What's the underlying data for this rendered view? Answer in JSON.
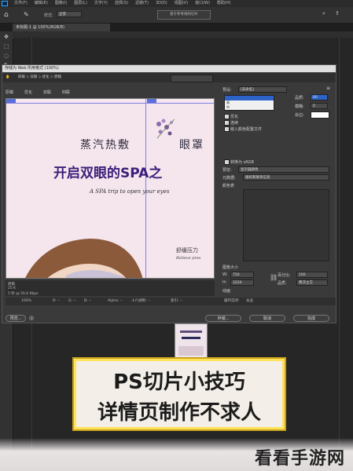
{
  "app": {
    "menu": [
      "文件(F)",
      "编辑(E)",
      "图像(I)",
      "图层(L)",
      "文字(Y)",
      "选择(S)",
      "滤镜(T)",
      "3D(D)",
      "视图(V)",
      "窗口(W)",
      "帮助(H)"
    ],
    "options": {
      "style_label": "样式:",
      "style_value": "正常",
      "slices_button": "基于参考线的切片"
    },
    "doc_tab": "未标题-1 @ 100%(RGB/8)"
  },
  "dialog": {
    "title": "存储为 Web 所用格式 (100%)",
    "tools_line": "四联  ◇  双联  ◇  优化  ◇  原稿",
    "tabs": [
      "原稿",
      "优化",
      "双联",
      "四联"
    ],
    "preview": {
      "line1": "蒸汽热敷",
      "line1b": "眼罩",
      "line2": "开启双眼的SPA之",
      "line3": "A SPA trip to open your eyes",
      "line4": "舒缓压力",
      "line4b": "Relieve pres"
    },
    "info": {
      "format": "原稿",
      "size": "25 K",
      "speed": "5 秒 @ 56.6 Kbps"
    },
    "status": {
      "zoom": "100%",
      "r": "R: --",
      "g": "G: --",
      "b": "B: --",
      "alpha": "Alpha: --",
      "hex": "十六进制: --",
      "index": "索引: --"
    },
    "settings": {
      "preset_label": "预设:",
      "preset_value": "[未命名]",
      "format_value": "JPEG",
      "quality_label": "品质:",
      "quality_value": "60",
      "blur_label": "模糊:",
      "blur_value": "0",
      "matte_label": "杂边:",
      "options": [
        "优化",
        "连续",
        "嵌入颜色配置文件"
      ],
      "dropdown_items": [
        "JPEG",
        "高",
        "中"
      ],
      "convert_label": "转换为 sRGB",
      "preview_label": "预览:",
      "preview_value": "显示器颜色",
      "metadata_label": "元数据:",
      "metadata_value": "版权和联系信息",
      "colortable_label": "颜色表",
      "image_size_label": "图像大小",
      "w_label": "W:",
      "w_value": "750",
      "h_label": "H:",
      "h_value": "3220",
      "pct_label": "百分比:",
      "pct_value": "100",
      "quality2_label": "品质:",
      "quality2_value": "两次立方",
      "anim_label": "动画",
      "loop_label": "循环选项:",
      "loop_value": "永远"
    },
    "buttons": {
      "preview": "预览...",
      "save": "存储...",
      "cancel": "取消",
      "done": "完成"
    }
  },
  "caption": {
    "line1": "PS切片小技巧",
    "line2": "详情页制作不求人"
  },
  "watermark": "看看手游网"
}
